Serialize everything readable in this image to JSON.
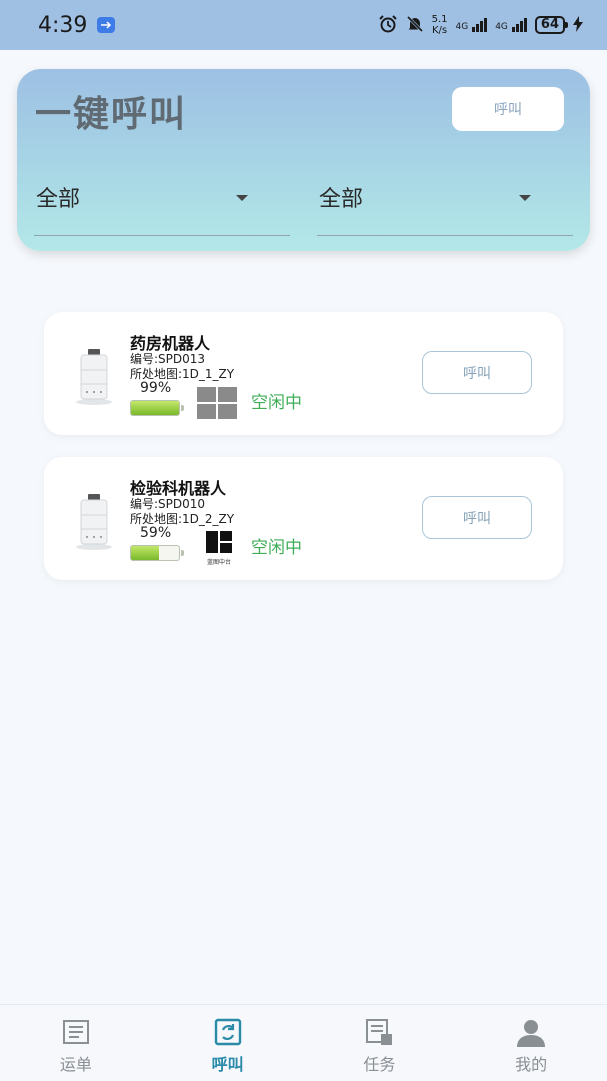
{
  "status_bar": {
    "time": "4:39",
    "net_speed_value": "5.1",
    "net_speed_unit": "K/s",
    "network1": "4G",
    "network2": "4G",
    "battery": "64"
  },
  "header": {
    "title": "一键呼叫",
    "call_label": "呼叫",
    "filter1": "全部",
    "filter2": "全部"
  },
  "robots": [
    {
      "name": "药房机器人",
      "code": "编号:SPD013",
      "map": "所处地图:1D_1_ZY",
      "battery": "99%",
      "battery_level": 99,
      "status": "空闲中",
      "call_label": "呼叫",
      "os_icon": "windows-icon"
    },
    {
      "name": "检验科机器人",
      "code": "编号:SPD010",
      "map": "所处地图:1D_2_ZY",
      "battery": "59%",
      "battery_level": 59,
      "status": "空闲中",
      "call_label": "呼叫",
      "os_icon": "harmony-icon",
      "os_caption": "蓝图中台"
    }
  ],
  "nav": {
    "items": [
      {
        "label": "运单",
        "icon": "waybill-icon"
      },
      {
        "label": "呼叫",
        "icon": "call-icon",
        "active": true
      },
      {
        "label": "任务",
        "icon": "task-icon"
      },
      {
        "label": "我的",
        "icon": "profile-icon"
      }
    ]
  },
  "colors": {
    "accent": "#2a8aa8",
    "status_idle": "#3fae57",
    "header_gradient_top": "#9dc0e4",
    "header_gradient_bottom": "#b3e8e8"
  }
}
